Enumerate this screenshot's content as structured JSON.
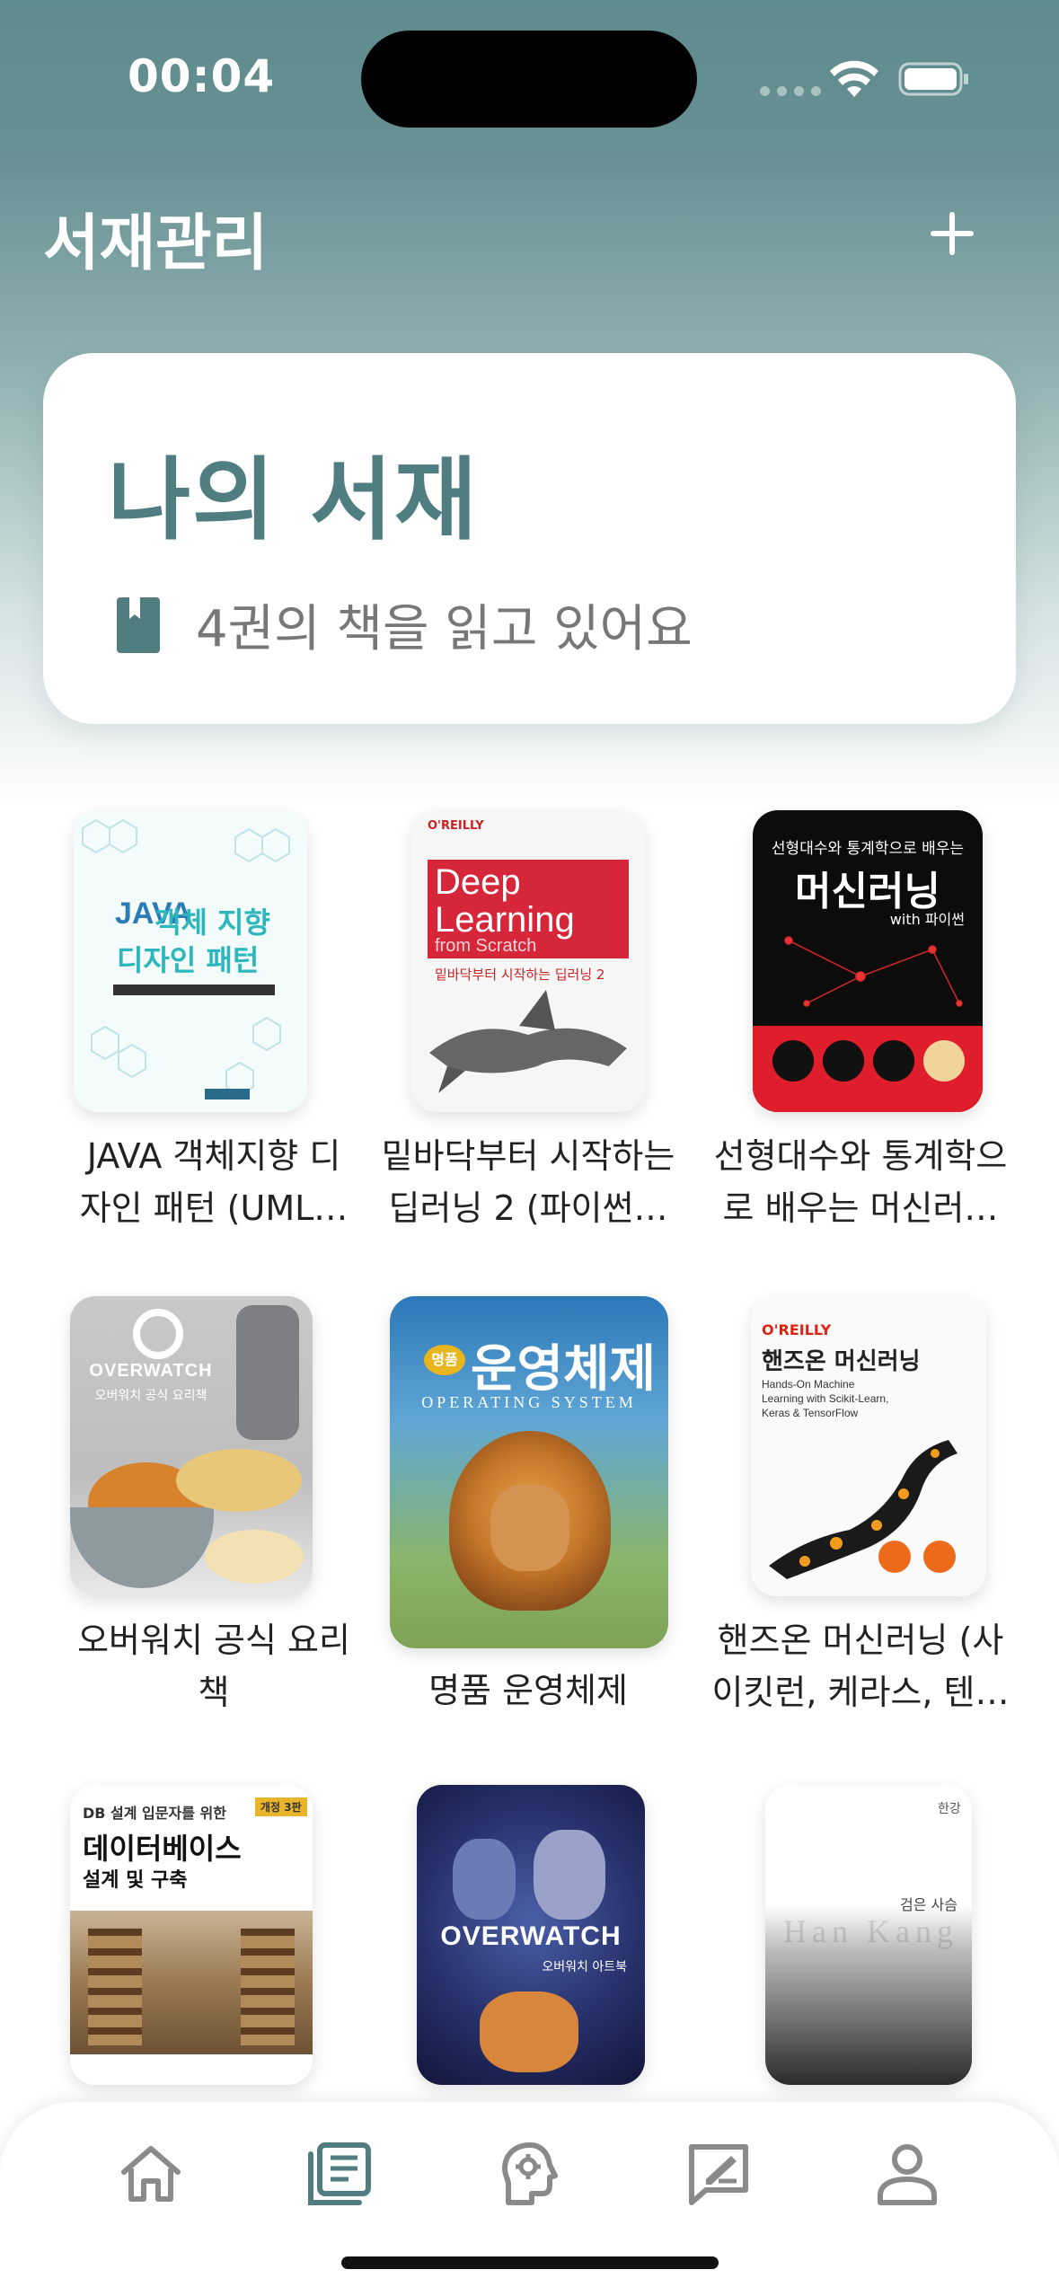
{
  "status_bar": {
    "time": "00:04"
  },
  "header": {
    "title": "서재관리",
    "add_label": "+"
  },
  "library": {
    "title": "나의 서재",
    "count_text": "4권의 책을 읽고 있어요"
  },
  "books": [
    {
      "title": "JAVA 객체지향 디자인 패턴 (UML…",
      "line1": "JAVA 객체지향 디",
      "line2": "자인 패턴 (UML…",
      "cover_line1": "JAVA",
      "cover_line2": "객체 지향",
      "cover_line3": "디자인 패턴"
    },
    {
      "title": "밑바닥부터 시작하는 딥러닝 2 (파이썬…",
      "line1": "밑바닥부터 시작하는",
      "line2": "딥러닝 2 (파이썬…",
      "cover_publisher": "O'REILLY",
      "cover_line1": "Deep",
      "cover_line2": "Learning",
      "cover_line3": "from Scratch",
      "cover_sub": "밑바닥부터 시작하는 딥러닝 2"
    },
    {
      "title": "선형대수와 통계학으로 배우는 머신러…",
      "line1": "선형대수와 통계학으",
      "line2": "로 배우는 머신러…",
      "cover_line1": "선형대수와 통계학으로 배우는",
      "cover_line2": "머신러닝",
      "cover_line3": "with 파이썬"
    },
    {
      "title": "오버워치 공식 요리 책",
      "line1": "오버워치 공식 요리",
      "line2": "책",
      "cover_line1": "OVERWATCH",
      "cover_line2": "오버워치 공식 요리책"
    },
    {
      "title": "명품 운영체제",
      "line1": "명품 운영체제",
      "line2": "",
      "cover_badge": "명품",
      "cover_line1": "운영체제",
      "cover_line2": "OPERATING SYSTEM"
    },
    {
      "title": "핸즈온 머신러닝 (사이킷런, 케라스, 텐…",
      "line1": "핸즈온 머신러닝 (사",
      "line2": "이킷런, 케라스, 텐…",
      "cover_publisher": "O'REILLY",
      "cover_line1": "핸즈온 머신러닝",
      "cover_line2": "Hands-On Machine Learning with Scikit-Learn, Keras & TensorFlow"
    },
    {
      "title": "데이터베이스 설계 및 구축",
      "line1": "",
      "line2": "",
      "cover_badge": "개정 3판",
      "cover_line0": "DB 설계 입문자를 위한",
      "cover_line1": "데이터베이스",
      "cover_line2": "설계 및 구축"
    },
    {
      "title": "오버워치 아트북",
      "line1": "",
      "line2": "",
      "cover_line1": "OVERWATCH",
      "cover_line2": "오버워치 아트북"
    },
    {
      "title": "검은 사슴",
      "line1": "",
      "line2": "",
      "cover_line0": "한강",
      "cover_line1": "검은 사슴",
      "cover_line2": "Han Kang"
    }
  ],
  "nav": {
    "items": [
      "home-icon",
      "library-icon",
      "brain-icon",
      "review-icon",
      "profile-icon"
    ],
    "active_index": 1,
    "active_color": "#4f7d80",
    "inactive_color": "#8a8a8a"
  },
  "colors": {
    "accent": "#4f7d80",
    "header_bg": "#5f8c8e"
  }
}
